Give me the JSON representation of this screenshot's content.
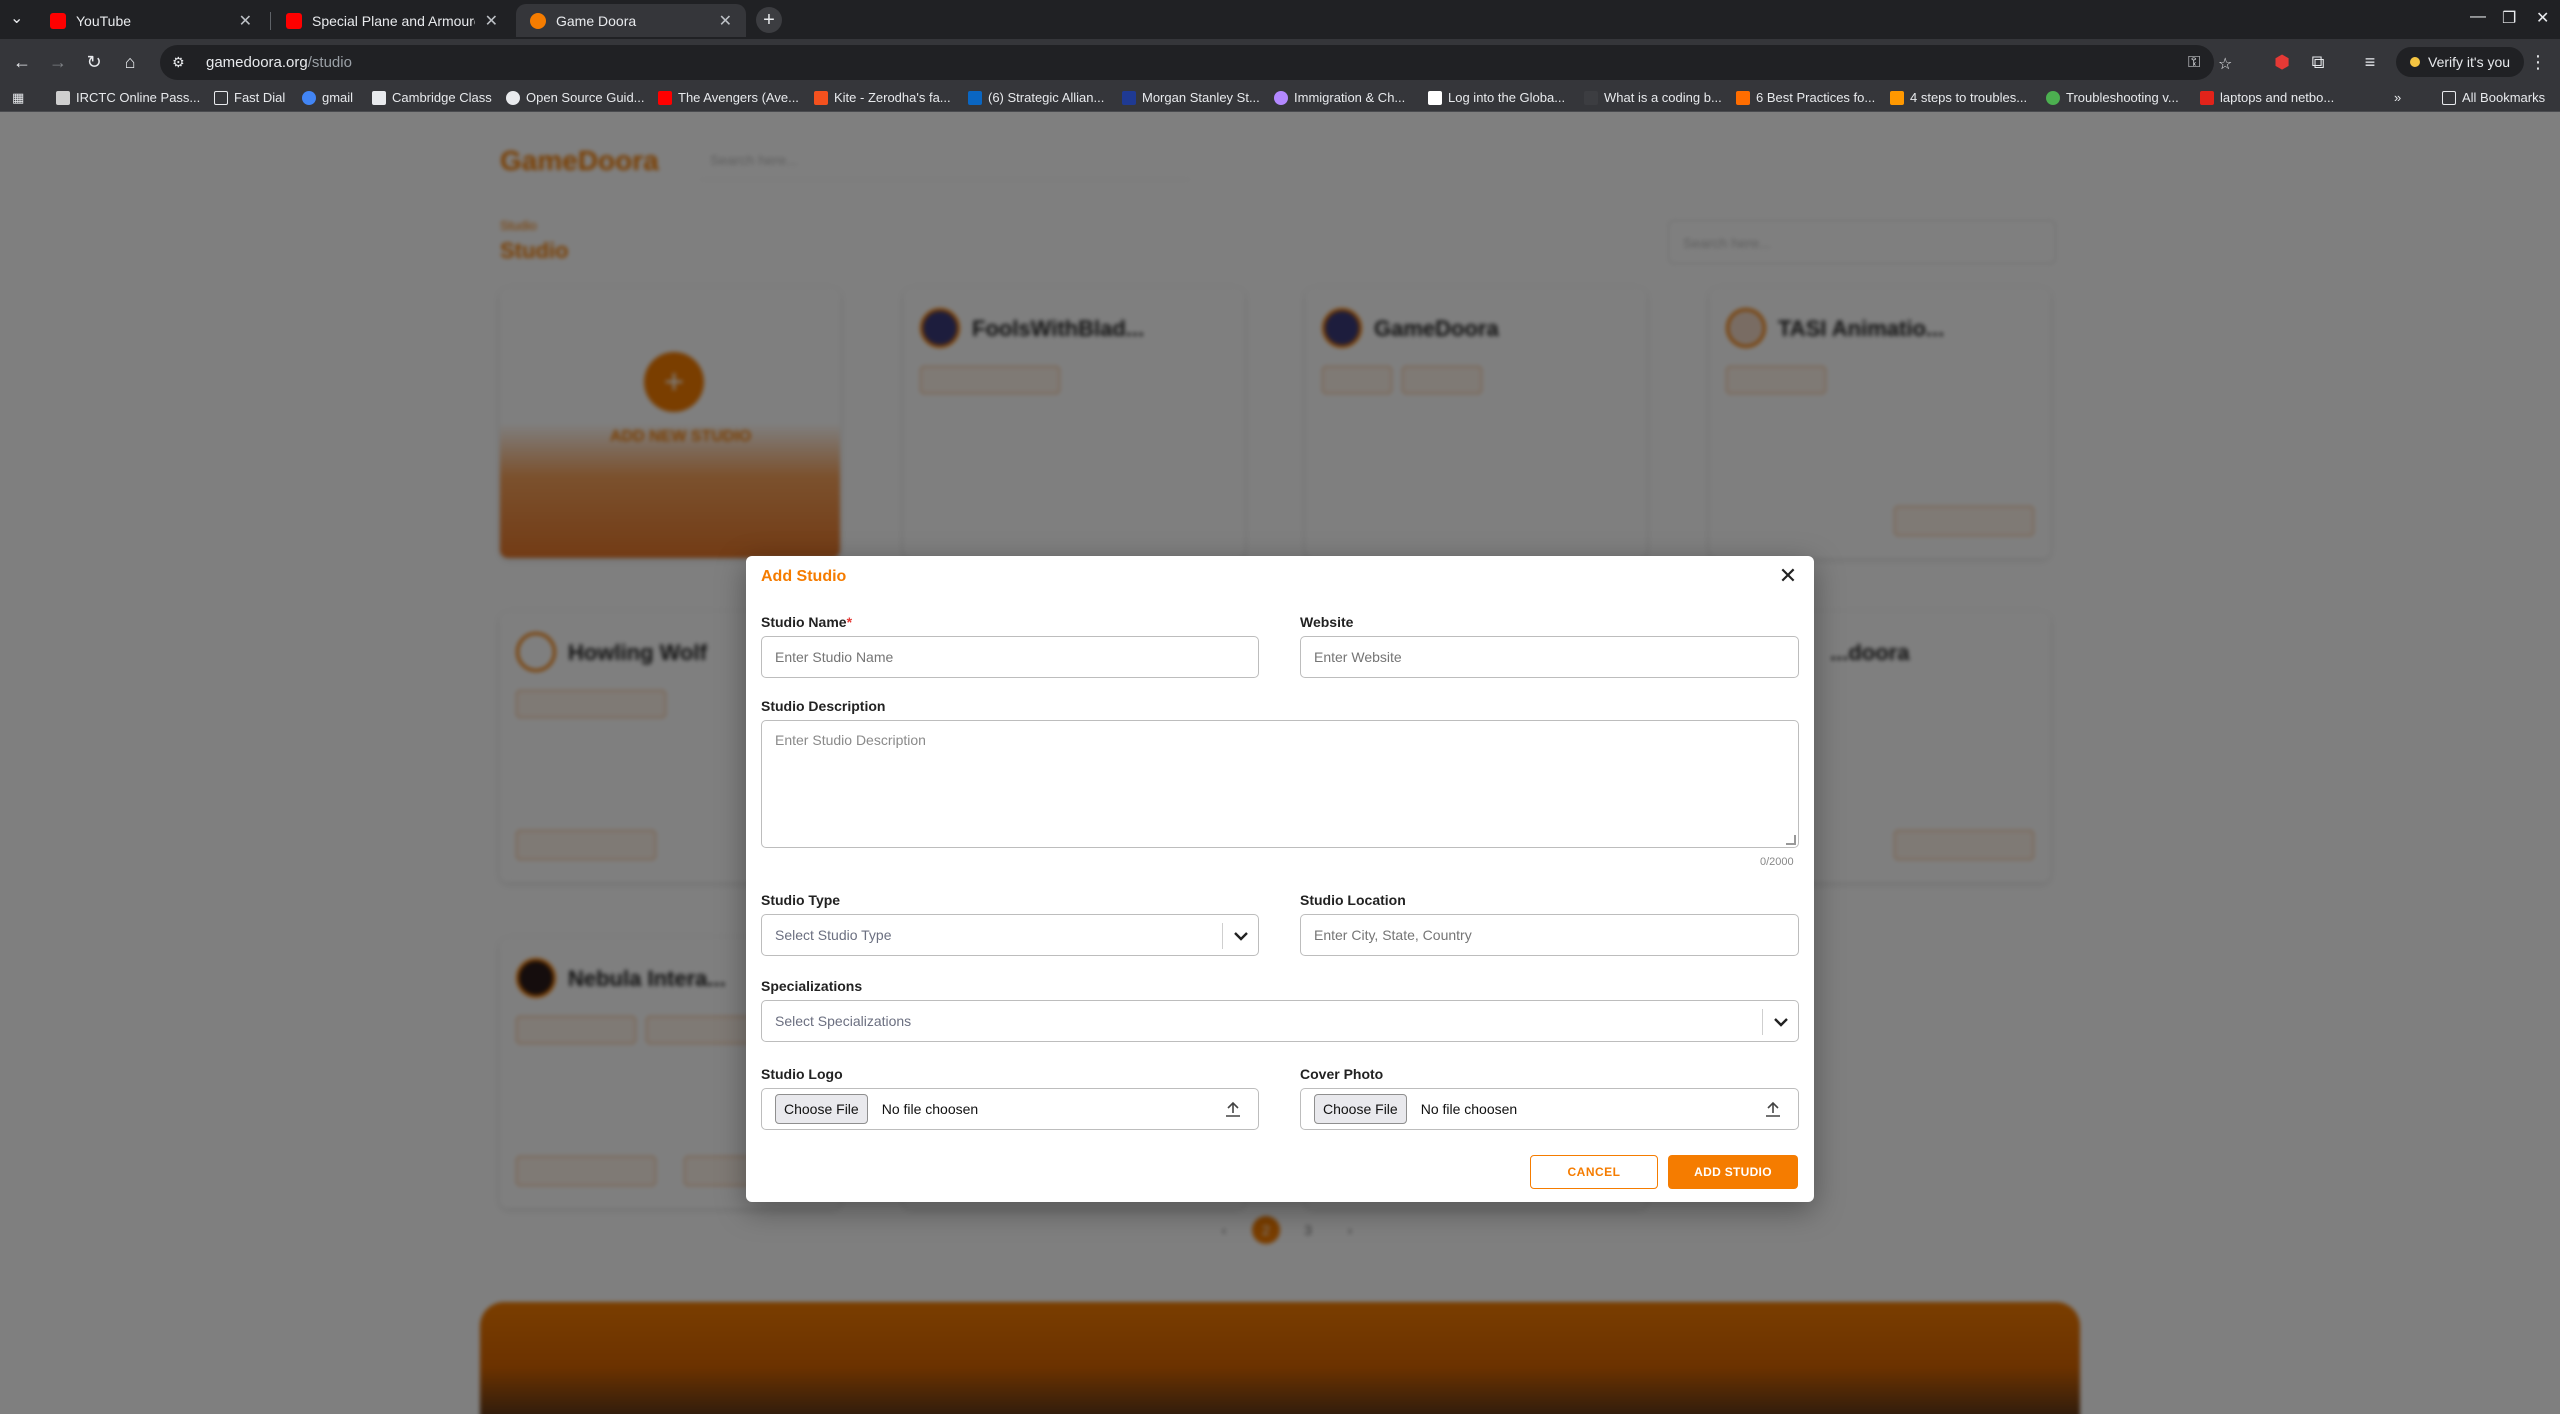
{
  "browser": {
    "tabs": [
      {
        "title": "YouTube",
        "favicon_color": "#ff0000",
        "active": false
      },
      {
        "title": "Special Plane and Armoured",
        "favicon_color": "#ff0000",
        "active": false
      },
      {
        "title": "Game Doora",
        "favicon_color": "#f57c00",
        "active": true
      }
    ],
    "url_host": "gamedoora.org",
    "url_path": "/studio",
    "profile_label": "Verify it's you",
    "bookmarks": [
      {
        "label": "IRCTC Online Pass..."
      },
      {
        "label": "Fast Dial"
      },
      {
        "label": "gmail"
      },
      {
        "label": "Cambridge Class"
      },
      {
        "label": "Open Source Guid..."
      },
      {
        "label": "The Avengers (Ave..."
      },
      {
        "label": "Kite - Zerodha's fa..."
      },
      {
        "label": "(6) Strategic Allian..."
      },
      {
        "label": "Morgan Stanley St..."
      },
      {
        "label": "Immigration & Ch..."
      },
      {
        "label": "Log into the Globa..."
      },
      {
        "label": "What is a coding b..."
      },
      {
        "label": "6 Best Practices fo..."
      },
      {
        "label": "4 steps to troubles..."
      },
      {
        "label": "Troubleshooting v..."
      },
      {
        "label": "laptops and netbo..."
      }
    ],
    "all_bookmarks": "All Bookmarks"
  },
  "background_page": {
    "site_name": "GameDoora",
    "search_placeholder": "Search here...",
    "breadcrumb": "Studio",
    "page_title": "Studio",
    "studio_search_placeholder": "Search here...",
    "add_card_label": "ADD NEW STUDIO",
    "cards": [
      {
        "name": "FoolsWithBlad..."
      },
      {
        "name": "GameDoora"
      },
      {
        "name": "TASI Animatio..."
      },
      {
        "name": "Howling Wolf"
      },
      {
        "name": "...doora"
      },
      {
        "name": "Nebula Intera..."
      }
    ],
    "pager": [
      "2",
      "3"
    ],
    "current_page": "2"
  },
  "modal": {
    "title": "Add Studio",
    "studio_name": {
      "label": "Studio Name",
      "required_mark": "*",
      "placeholder": "Enter Studio Name",
      "value": ""
    },
    "website": {
      "label": "Website",
      "placeholder": "Enter Website",
      "value": ""
    },
    "description": {
      "label": "Studio Description",
      "placeholder": "Enter Studio Description",
      "counter": "0/2000"
    },
    "studio_type": {
      "label": "Studio Type",
      "selected": "Select Studio Type"
    },
    "location": {
      "label": "Studio Location",
      "placeholder": "Enter City, State, Country"
    },
    "specializations": {
      "label": "Specializations",
      "selected": "Select Specializations"
    },
    "logo": {
      "label": "Studio Logo",
      "button": "Choose File",
      "status": "No file choosen"
    },
    "cover": {
      "label": "Cover Photo",
      "button": "Choose File",
      "status": "No file choosen"
    },
    "cancel_label": "CANCEL",
    "submit_label": "ADD STUDIO"
  },
  "colors": {
    "accent": "#f57c00",
    "required": "#e53935"
  }
}
